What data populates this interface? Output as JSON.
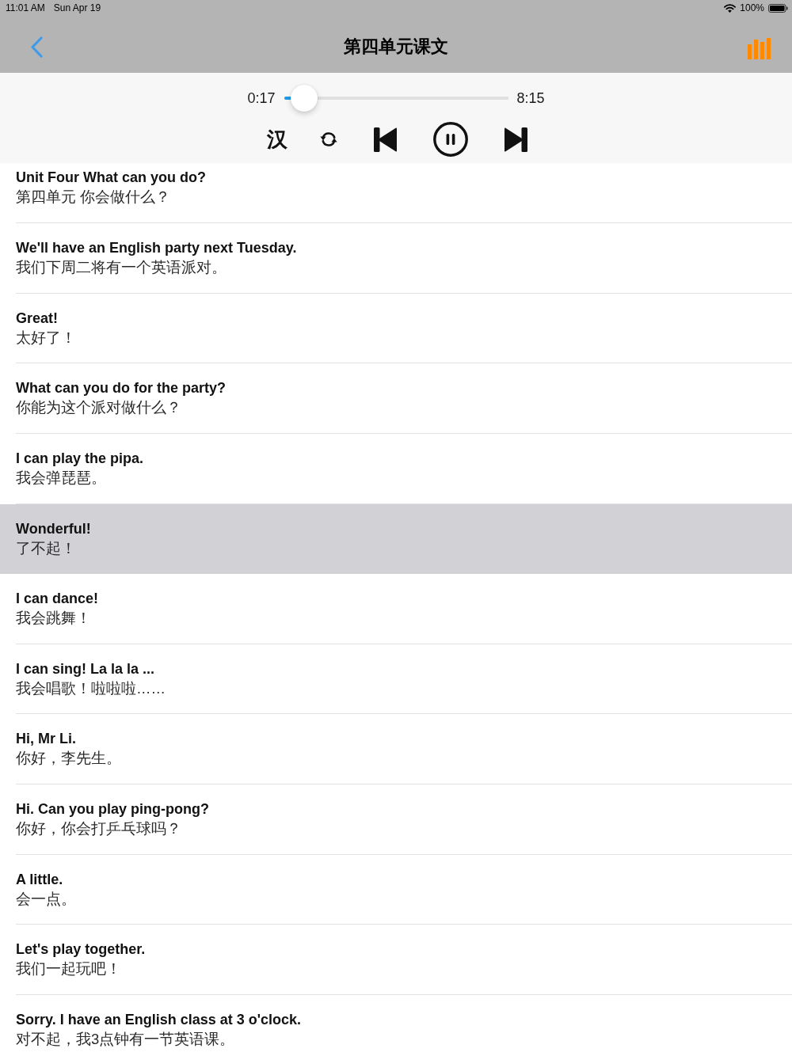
{
  "status_bar": {
    "time": "11:01 AM",
    "date": "Sun Apr 19",
    "battery": "100%"
  },
  "nav_bar": {
    "title": "第四单元课文"
  },
  "player": {
    "elapsed": "0:17",
    "duration": "8:15",
    "level": 0.034,
    "language_toggle": "汉",
    "playing": true
  },
  "lines": [
    {
      "english": "Unit Four What can you do?",
      "chinese": "第四单元 你会做什么？",
      "selected": false
    },
    {
      "english": "We'll have an English party next Tuesday.",
      "chinese": "我们下周二将有一个英语派对。",
      "selected": false
    },
    {
      "english": "Great!",
      "chinese": "太好了！",
      "selected": false
    },
    {
      "english": "What can you do for the party?",
      "chinese": "你能为这个派对做什么？",
      "selected": false
    },
    {
      "english": "I can play the pipa.",
      "chinese": "我会弹琵琶。",
      "selected": false
    },
    {
      "english": "Wonderful!",
      "chinese": "了不起！",
      "selected": true
    },
    {
      "english": "I can dance!",
      "chinese": "我会跳舞！",
      "selected": false
    },
    {
      "english": "I can sing! La la la ...",
      "chinese": "我会唱歌！啦啦啦……",
      "selected": false
    },
    {
      "english": "Hi, Mr Li.",
      "chinese": "你好，李先生。",
      "selected": false
    },
    {
      "english": "Hi. Can you play ping-pong?",
      "chinese": "你好，你会打乒乓球吗？",
      "selected": false
    },
    {
      "english": "A little.",
      "chinese": "会一点。",
      "selected": false
    },
    {
      "english": "Let's play together.",
      "chinese": "我们一起玩吧！",
      "selected": false
    },
    {
      "english": "Sorry. I have an English class at 3 o'clock.",
      "chinese": "对不起，我3点钟有一节英语课。",
      "selected": false
    }
  ]
}
